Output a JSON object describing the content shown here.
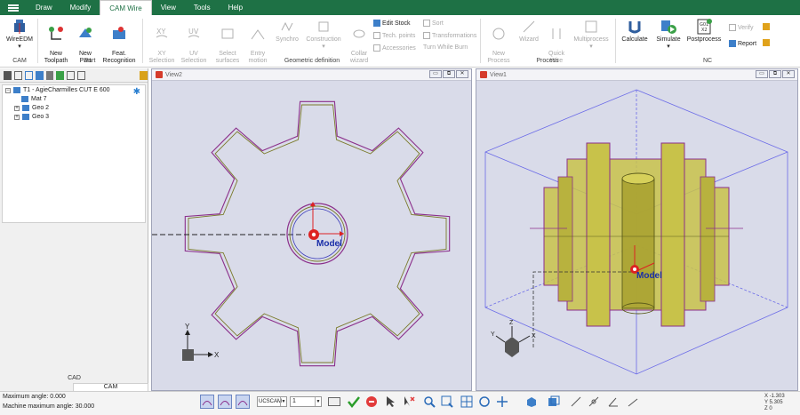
{
  "menu": {
    "tabs": [
      "Draw",
      "Modify",
      "CAM Wire",
      "View",
      "Tools",
      "Help"
    ],
    "active_tab": "CAM Wire"
  },
  "ribbon": {
    "cam_group": {
      "label": "CAM",
      "wire_edm": "WireEDM"
    },
    "part_group": {
      "label": "Part",
      "new_toolpath": "New\nToolpath",
      "new_part": "New\nPart",
      "feat_recognition": "Feat.\nRecognition"
    },
    "geo_group": {
      "label": "Geometric definition",
      "xy_selection": "XY\nSelection",
      "uv_selection": "UV\nSelection",
      "select_surfaces": "Select\nsurfaces",
      "entry_motion": "Entry\nmotion",
      "synchro": "Synchro",
      "construction": "Construction",
      "collar_wizard": "Collar\nwizard",
      "edit_stock": "Edit Stock",
      "tech_points": "Tech. points",
      "accessories": "Accessories",
      "sort": "Sort",
      "transformations": "Transformations",
      "turn_while_burn": "Turn While Burn"
    },
    "process_group": {
      "label": "Process",
      "new_process": "New\nProcess",
      "wizard": "Wizard",
      "quick_wire": "Quick\nWire",
      "multiprocess": "Multiprocess"
    },
    "nc_group": {
      "label": "NC",
      "calculate": "Calculate",
      "simulate": "Simulate",
      "postprocess": "Postprocess",
      "verify": "Verify",
      "report": "Report"
    }
  },
  "tree": {
    "root": "T1 - AgieCharmilles CUT E 600",
    "items": [
      "Mat 7",
      "Geo 2",
      "Geo 3"
    ]
  },
  "left_tabs": {
    "cad": "CAD",
    "cam": "CAM"
  },
  "views": {
    "left": {
      "title": "View2",
      "model_label": "Model",
      "axis_y": "Y",
      "axis_x": "X"
    },
    "right": {
      "title": "View1",
      "model_label": "Model",
      "axis_y": "Y",
      "axis_x": "X",
      "axis_z": "Z"
    }
  },
  "status": {
    "max_angle": "Maximum angle: 0.000",
    "machine_max_angle": "Machine maximum angle: 30.000",
    "ucs": "UCSCAM",
    "layer": "1",
    "coord_x": "X -1.303",
    "coord_y": "Y 5.305",
    "coord_z": "Z 0"
  },
  "colors": {
    "menubar": "#1e7145",
    "viewport_bg": "#d9dbe9",
    "contour_purple": "#8b2f8b",
    "contour_olive": "#7a7a2a",
    "solid_yellow": "#c8c24a",
    "box_blue": "#5a5ae0"
  }
}
